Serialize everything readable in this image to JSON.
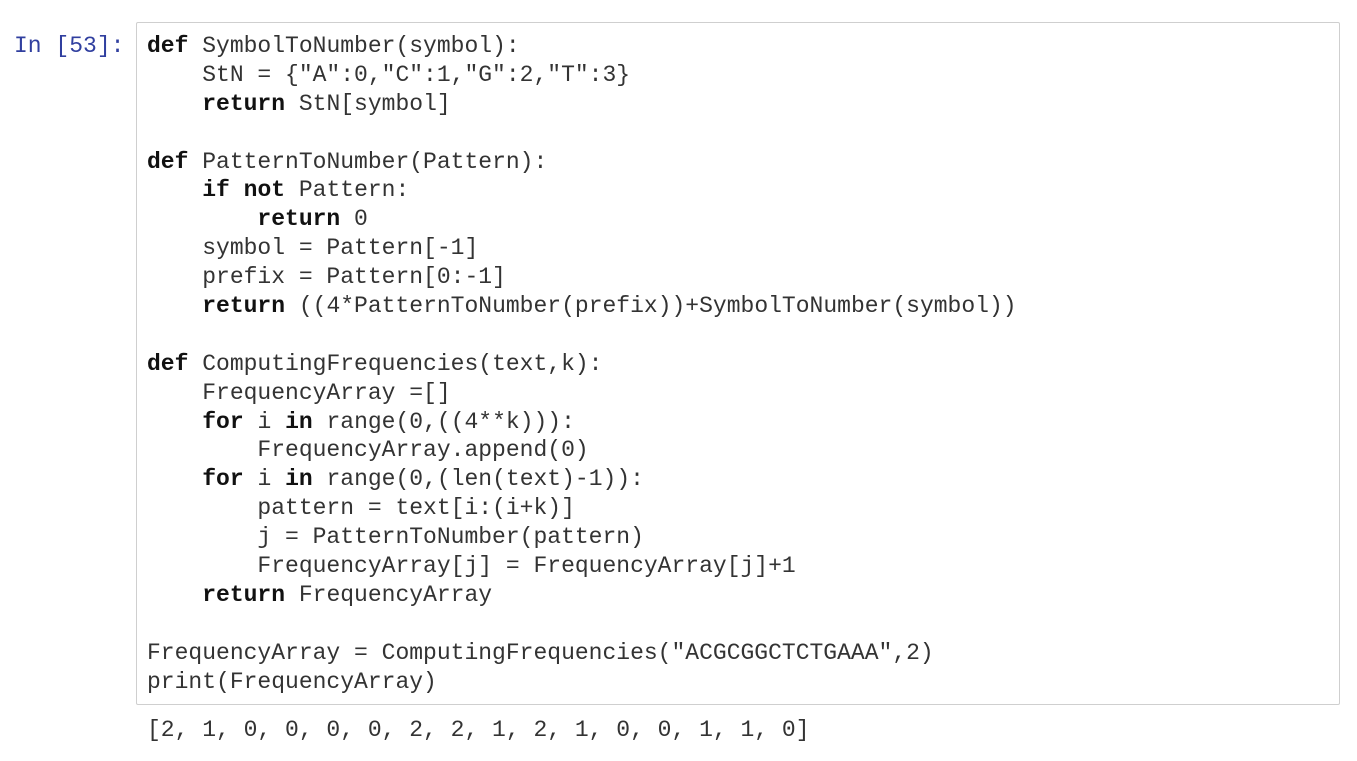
{
  "cell": {
    "prompt": "In [53]:",
    "output": "[2, 1, 0, 0, 0, 0, 2, 2, 1, 2, 1, 0, 0, 1, 1, 0]",
    "code_lines": [
      [
        {
          "t": "def",
          "kw": true
        },
        {
          "t": " SymbolToNumber(symbol):"
        }
      ],
      [
        {
          "t": "    StN = {\"A\":0,\"C\":1,\"G\":2,\"T\":3}"
        }
      ],
      [
        {
          "t": "    "
        },
        {
          "t": "return",
          "kw": true
        },
        {
          "t": " StN[symbol]"
        }
      ],
      [
        {
          "t": ""
        }
      ],
      [
        {
          "t": "def",
          "kw": true
        },
        {
          "t": " PatternToNumber(Pattern):"
        }
      ],
      [
        {
          "t": "    "
        },
        {
          "t": "if",
          "kw": true
        },
        {
          "t": " "
        },
        {
          "t": "not",
          "kw": true
        },
        {
          "t": " Pattern:"
        }
      ],
      [
        {
          "t": "        "
        },
        {
          "t": "return",
          "kw": true
        },
        {
          "t": " 0"
        }
      ],
      [
        {
          "t": "    symbol = Pattern[-1]"
        }
      ],
      [
        {
          "t": "    prefix = Pattern[0:-1]"
        }
      ],
      [
        {
          "t": "    "
        },
        {
          "t": "return",
          "kw": true
        },
        {
          "t": " ((4*PatternToNumber(prefix))+SymbolToNumber(symbol))"
        }
      ],
      [
        {
          "t": ""
        }
      ],
      [
        {
          "t": "def",
          "kw": true
        },
        {
          "t": " ComputingFrequencies(text,k):"
        }
      ],
      [
        {
          "t": "    FrequencyArray =[]"
        }
      ],
      [
        {
          "t": "    "
        },
        {
          "t": "for",
          "kw": true
        },
        {
          "t": " i "
        },
        {
          "t": "in",
          "kw": true
        },
        {
          "t": " range(0,((4**k))):"
        }
      ],
      [
        {
          "t": "        FrequencyArray.append(0)"
        }
      ],
      [
        {
          "t": "    "
        },
        {
          "t": "for",
          "kw": true
        },
        {
          "t": " i "
        },
        {
          "t": "in",
          "kw": true
        },
        {
          "t": " range(0,(len(text)-1)):"
        }
      ],
      [
        {
          "t": "        pattern = text[i:(i+k)]"
        }
      ],
      [
        {
          "t": "        j = PatternToNumber(pattern)"
        }
      ],
      [
        {
          "t": "        FrequencyArray[j] = FrequencyArray[j]+1"
        }
      ],
      [
        {
          "t": "    "
        },
        {
          "t": "return",
          "kw": true
        },
        {
          "t": " FrequencyArray"
        }
      ],
      [
        {
          "t": ""
        }
      ],
      [
        {
          "t": "FrequencyArray = ComputingFrequencies(\"ACGCGGCTCTGAAA\",2)"
        }
      ],
      [
        {
          "t": "print(FrequencyArray)"
        }
      ]
    ]
  }
}
